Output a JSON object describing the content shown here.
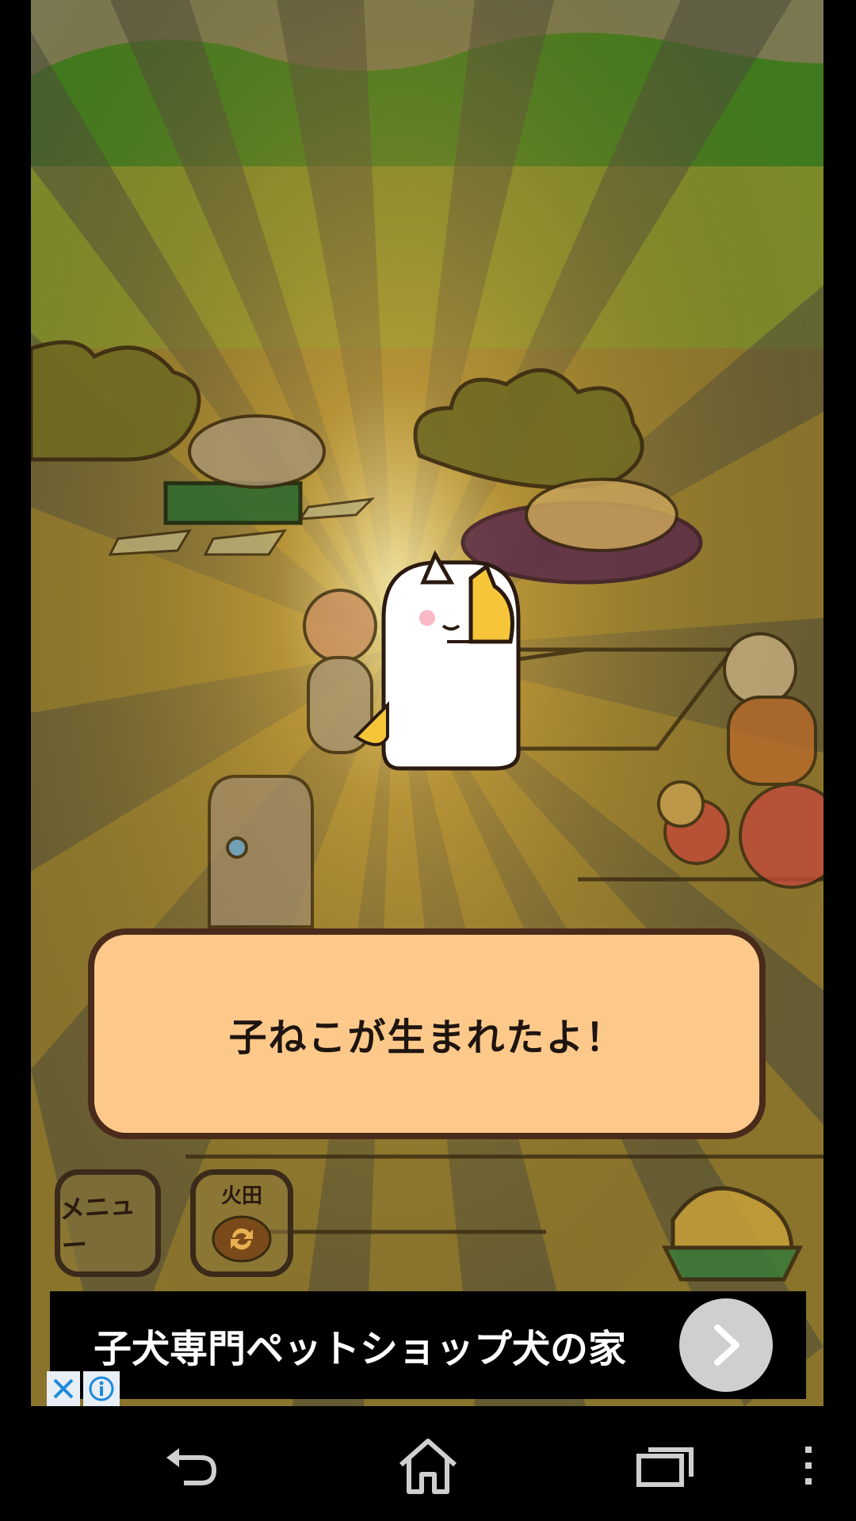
{
  "dialog": {
    "message": "子ねこが生まれたよ！"
  },
  "buttons": {
    "menu_label": "メニュー",
    "field_label": "火田"
  },
  "ad": {
    "text": "子犬専門ペットショップ犬の家",
    "arrow_icon": "chevron-right-icon",
    "close_icon": "close-icon",
    "info_icon": "info-icon"
  },
  "navbar": {
    "back_icon": "back-icon",
    "home_icon": "home-icon",
    "recent_icon": "recent-apps-icon",
    "overflow_icon": "overflow-menu-icon"
  },
  "colors": {
    "dialog_bg": "#fcc98a",
    "dialog_border": "#4a2a1a",
    "ray_light": "#d9b43a",
    "ray_dark": "#5e5a2c",
    "nav_bg": "#000000"
  }
}
